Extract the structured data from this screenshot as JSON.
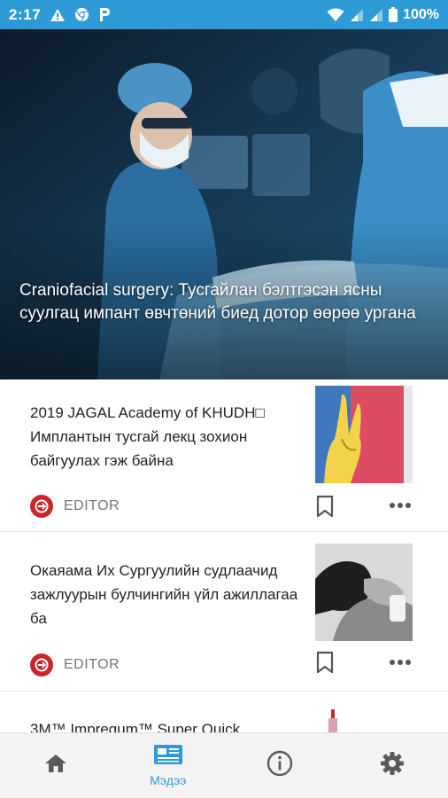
{
  "status_bar": {
    "time": "2:17",
    "battery": "100%",
    "left_icons": [
      "alert-icon",
      "chrome-icon",
      "parking-icon"
    ],
    "right_icons": [
      "wifi-icon",
      "signal-icon",
      "signal-icon",
      "battery-icon"
    ]
  },
  "hero": {
    "title": "Craniofacial surgery: Тусгайлан бэлтгэсэн ясны суулгац импант өвчтөний биед дотор өөрөө ургана",
    "slide_count": 2,
    "active_slide": 2
  },
  "articles": [
    {
      "title": "2019 JAGAL Academy of KHUDH□ Имплантын тусгай лекц зохион байгуулах гэж байна",
      "source": "EDITOR",
      "thumbnail": "hand-illustration"
    },
    {
      "title": "Окаяама Их Сургуулийн судлаачид зажлуурын булчингийн үйл ажиллагаа ба",
      "source": "EDITOR",
      "thumbnail": "face-profile-photo"
    }
  ],
  "partial_article": {
    "title": "3M™ Impregum™ Super Quick"
  },
  "bottom_nav": {
    "items": [
      {
        "icon": "home-icon",
        "label": ""
      },
      {
        "icon": "news-icon",
        "label": "Мэдээ"
      },
      {
        "icon": "info-icon",
        "label": ""
      },
      {
        "icon": "settings-icon",
        "label": ""
      }
    ],
    "active_index": 1
  },
  "colors": {
    "status_bar": "#2f9bd6",
    "accent": "#2f9bd6",
    "source_logo": "#c9262c",
    "nav_background": "#f3f3f3"
  }
}
